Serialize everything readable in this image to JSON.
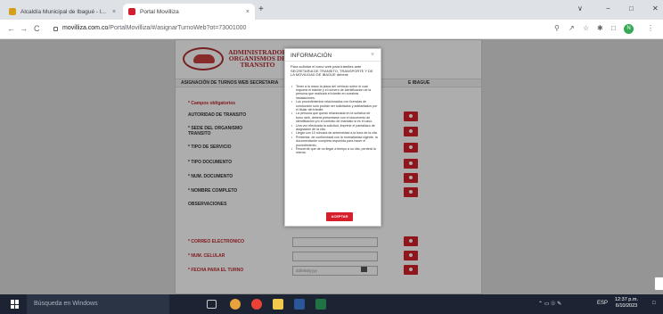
{
  "browser": {
    "tabs": [
      {
        "title": "Alcaldía Municipal de Ibagué - I...",
        "close": "×"
      },
      {
        "title": "Portal Movilliza",
        "close": "×"
      }
    ],
    "new_tab": "+",
    "window_controls": {
      "minimize": "∨",
      "restore": "−",
      "maximize": "□",
      "close": "✕"
    },
    "nav": {
      "back": "←",
      "forward": "→",
      "reload": "C"
    },
    "url_host": "movilliza.com.co",
    "url_path": "/PortalMovilliza/#/asignarTurnoWeb?ot=73001000",
    "profile_initial": "N"
  },
  "page": {
    "logo_text": [
      "ADMINISTRADOR",
      "ORGANISMOS DE",
      "TRANSITO"
    ],
    "strip_title": "ASIGNACIÓN DE TURNOS WEB SECRETARIA",
    "strip_right": "E IBAGUE",
    "required_note": "* Campos obligatorios",
    "fields": {
      "autoridad": "AUTORIDAD DE TRANSITO",
      "sede": "* SEDE DEL ORGANISMO TRANSITO",
      "tipo_servicio": "* TIPO DE SERVICIO",
      "tipo_documento": "* TIPO DOCUMENTO",
      "num_documento": "* NUM. DOCUMENTO",
      "nombre": "* NOMBRE COMPLETO",
      "observaciones": "OBSERVACIONES",
      "correo": "* CORREO ELECTRONICO",
      "celular": "* NUM. CELULAR",
      "fecha": "* FECHA PARA EL TURNO"
    },
    "date_placeholder": "dd/MM/yyyy"
  },
  "modal": {
    "title": "INFORMACIÓN",
    "close": "×",
    "intro": "Para solicitar el turno web para trámites ante SECRETARIA DE TRANSITO, TRANSPORTE Y DE LA MOVILIDAD DE IBAGUE deberá:",
    "items": [
      "Tener a la mano la placa del vehículo sobre el cual requiera el trámite y el número de identificación de la persona que realizará el trámite en nuestras instalaciones.",
      "Los procedimientos relacionados con licencias de conducción solo podrán ser solicitados y adelantados por el titular del trámite.",
      "La persona que quedó relacionada en la solicitud de turno web, deberá presentarse con el documento de identificación y/o el contrato de mandato si es el caso.",
      "Una vez efectuada la solicitud, imprimir el pantallazo de asignación de la cita.",
      "Llegar con 10 minutos de anterioridad a la hora de la cita.",
      "Presentar, de conformidad con la normatividad vigente, la documentación completa requerida para hacer el procedimiento.",
      "Recuerde que de no llegar a tiempo a su cita, perderá la misma."
    ],
    "accept": "ACEPTAR"
  },
  "taskbar": {
    "search_placeholder": "Búsqueda en Windows",
    "language": "ESP",
    "time": "12:37 p.m.",
    "date": "6/10/2023"
  }
}
